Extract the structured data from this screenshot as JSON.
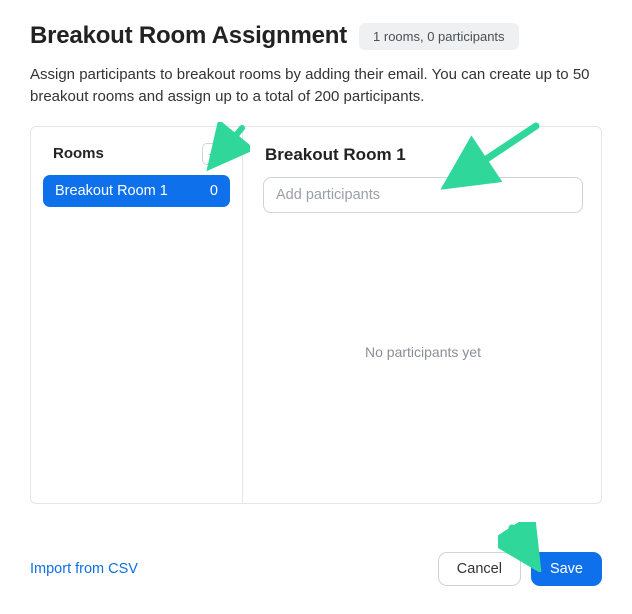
{
  "header": {
    "title": "Breakout Room Assignment",
    "badge": "1 rooms, 0 participants"
  },
  "description": "Assign participants to breakout rooms by adding their email. You can create up to 50 breakout rooms and assign up to a total of 200 participants.",
  "sidebar": {
    "heading": "Rooms",
    "add_glyph": "+",
    "items": [
      {
        "name": "Breakout Room 1",
        "count": "0"
      }
    ]
  },
  "panel": {
    "title": "Breakout Room 1",
    "add_placeholder": "Add participants",
    "empty_text": "No participants yet"
  },
  "footer": {
    "import_link": "Import from CSV",
    "cancel": "Cancel",
    "save": "Save"
  },
  "colors": {
    "primary": "#0e71eb",
    "annotation": "#2fd89a"
  }
}
